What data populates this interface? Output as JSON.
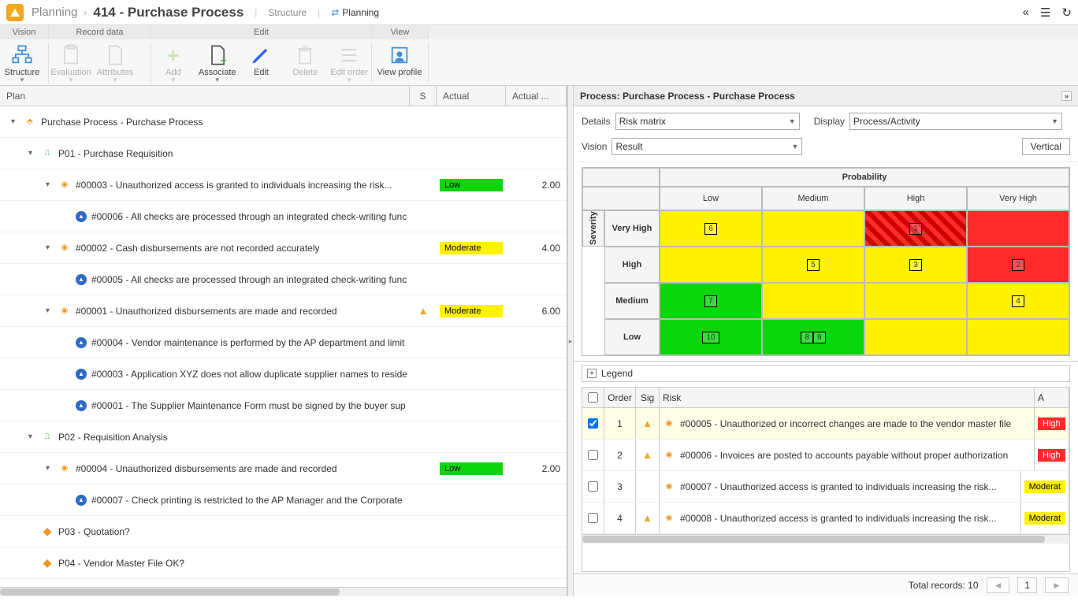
{
  "breadcrumb": {
    "module": "Planning",
    "title": "414 - Purchase Process",
    "tab1": "Structure",
    "tab2": "Planning"
  },
  "ribbon_tabs": {
    "vision": "Vision",
    "record": "Record data",
    "edit": "Edit",
    "view": "View"
  },
  "ribbon": {
    "structure": "Structure",
    "evaluation": "Evaluation",
    "attributes": "Attributes",
    "add": "Add",
    "associate": "Associate",
    "edit": "Edit",
    "delete": "Delete",
    "editorder": "Edit order",
    "viewprofile": "View profile"
  },
  "grid_headers": {
    "plan": "Plan",
    "s": "S",
    "actual": "Actual",
    "actual2": "Actual ..."
  },
  "tree": [
    {
      "lvl": 0,
      "caret": "▾",
      "icon": "proc",
      "text": "Purchase Process - Purchase Process"
    },
    {
      "lvl": 1,
      "caret": "▾",
      "icon": "act",
      "text": "P01 - Purchase Requisition"
    },
    {
      "lvl": 2,
      "caret": "▾",
      "icon": "risk",
      "text": "#00003 - Unauthorized access is granted to individuals increasing the risk...",
      "actual": "Low",
      "acls": "b-low",
      "val": "2.00"
    },
    {
      "lvl": 3,
      "caret": "",
      "icon": "ctrl",
      "text": "#00006 - All checks are processed through an integrated check-writing func"
    },
    {
      "lvl": 2,
      "caret": "▾",
      "icon": "risk",
      "text": "#00002 - Cash disbursements are not recorded accurately",
      "actual": "Moderate",
      "acls": "b-mod",
      "val": "4.00"
    },
    {
      "lvl": 3,
      "caret": "",
      "icon": "ctrl",
      "text": "#00005 - All checks are processed through an integrated check-writing func"
    },
    {
      "lvl": 2,
      "caret": "▾",
      "icon": "risk",
      "text": "#00001 - Unauthorized disbursements are made and recorded",
      "s": "warn",
      "actual": "Moderate",
      "acls": "b-mod",
      "val": "6.00"
    },
    {
      "lvl": 3,
      "caret": "",
      "icon": "ctrl",
      "text": "#00004 - Vendor maintenance is performed by the AP department and limit"
    },
    {
      "lvl": 3,
      "caret": "",
      "icon": "ctrl",
      "text": "#00003 - Application XYZ does not allow duplicate supplier names to reside"
    },
    {
      "lvl": 3,
      "caret": "",
      "icon": "ctrl",
      "text": "#00001 - The Supplier Maintenance Form must be signed by the buyer sup"
    },
    {
      "lvl": 1,
      "caret": "▾",
      "icon": "act",
      "text": "P02 - Requisition Analysis"
    },
    {
      "lvl": 2,
      "caret": "▾",
      "icon": "risk",
      "text": "#00004 - Unauthorized disbursements are made and recorded",
      "actual": "Low",
      "acls": "b-low",
      "val": "2.00"
    },
    {
      "lvl": 3,
      "caret": "",
      "icon": "ctrl",
      "text": "#00007 - Check printing is restricted to the AP Manager and the Corporate"
    },
    {
      "lvl": 1,
      "caret": "",
      "icon": "q",
      "text": "P03 - Quotation?"
    },
    {
      "lvl": 1,
      "caret": "",
      "icon": "q",
      "text": "P04 - Vendor Master File OK?"
    }
  ],
  "panel": {
    "title": "Process: Purchase Process - Purchase Process",
    "details_lbl": "Details",
    "details_val": "Risk matrix",
    "display_lbl": "Display",
    "display_val": "Process/Activity",
    "vision_lbl": "Vision",
    "vision_val": "Result",
    "vertical": "Vertical",
    "prob": "Probability",
    "sev": "Severity",
    "cols": [
      "Low",
      "Medium",
      "High",
      "Very High"
    ],
    "rows": [
      "Very High",
      "High",
      "Medium",
      "Low"
    ],
    "legend": "Legend"
  },
  "chart_data": {
    "type": "heatmap",
    "title": "Risk matrix",
    "xlabel": "Probability",
    "ylabel": "Severity",
    "x_categories": [
      "Low",
      "Medium",
      "High",
      "Very High"
    ],
    "y_categories": [
      "Very High",
      "High",
      "Medium",
      "Low"
    ],
    "color_levels": {
      "green": "Low",
      "yellow": "Moderate",
      "red": "High"
    },
    "grid_colors": [
      [
        "yellow",
        "yellow",
        "red-hatched",
        "red"
      ],
      [
        "yellow",
        "yellow",
        "yellow",
        "red"
      ],
      [
        "green",
        "yellow",
        "yellow",
        "yellow"
      ],
      [
        "green",
        "green",
        "yellow",
        "yellow"
      ]
    ],
    "cell_items": [
      {
        "severity": "Very High",
        "probability": "Low",
        "ids": [
          6
        ]
      },
      {
        "severity": "Very High",
        "probability": "High",
        "ids": [
          1
        ]
      },
      {
        "severity": "High",
        "probability": "Medium",
        "ids": [
          5
        ]
      },
      {
        "severity": "High",
        "probability": "High",
        "ids": [
          3
        ]
      },
      {
        "severity": "High",
        "probability": "Very High",
        "ids": [
          2
        ]
      },
      {
        "severity": "Medium",
        "probability": "Low",
        "ids": [
          7
        ]
      },
      {
        "severity": "Medium",
        "probability": "Very High",
        "ids": [
          4
        ]
      },
      {
        "severity": "Low",
        "probability": "Low",
        "ids": [
          10
        ]
      },
      {
        "severity": "Low",
        "probability": "Medium",
        "ids": [
          8,
          9
        ]
      }
    ]
  },
  "risk_headers": {
    "order": "Order",
    "sig": "Sig",
    "risk": "Risk",
    "a": "A"
  },
  "risks": [
    {
      "chk": true,
      "order": "1",
      "sig": true,
      "text": "#00005 - Unauthorized or incorrect changes are made to the vendor master file",
      "a": "High",
      "acls": "b-high"
    },
    {
      "chk": false,
      "order": "2",
      "sig": true,
      "text": "#00006 - Invoices are posted to accounts payable without proper authorization",
      "a": "High",
      "acls": "b-high"
    },
    {
      "chk": false,
      "order": "3",
      "sig": false,
      "text": "#00007 - Unauthorized access is granted to individuals increasing the risk...",
      "a": "Moderat",
      "acls": "b-mod"
    },
    {
      "chk": false,
      "order": "4",
      "sig": true,
      "text": "#00008 - Unauthorized access is granted to individuals increasing the risk...",
      "a": "Moderat",
      "acls": "b-mod"
    }
  ],
  "footer": {
    "total_lbl": "Total records:",
    "total": "10",
    "page": "1"
  }
}
